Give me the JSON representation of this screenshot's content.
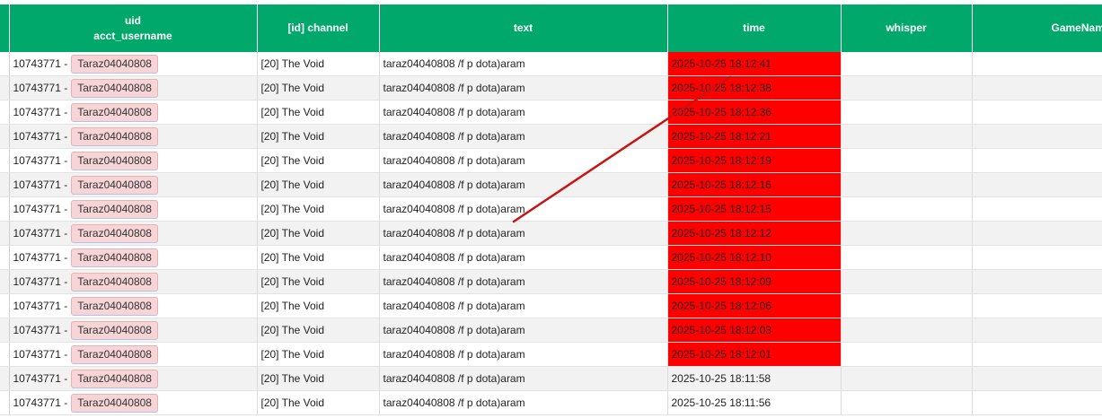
{
  "table": {
    "headers": {
      "uid_top": "uid",
      "uid_bottom": "acct_username",
      "channel": "[id] channel",
      "text": "text",
      "time": "time",
      "whisper": "whisper",
      "gamename": "GameNam"
    },
    "rows": [
      {
        "uid": "10743771 -",
        "username": "Taraz04040808",
        "channel": "[20] The Void",
        "text": "taraz04040808 /f p dota)aram",
        "time": "2025-10-25 18:12:41",
        "highlight": true
      },
      {
        "uid": "10743771 -",
        "username": "Taraz04040808",
        "channel": "[20] The Void",
        "text": "taraz04040808 /f p dota)aram",
        "time": "2025-10-25 18:12:38",
        "highlight": true
      },
      {
        "uid": "10743771 -",
        "username": "Taraz04040808",
        "channel": "[20] The Void",
        "text": "taraz04040808 /f p dota)aram",
        "time": "2025-10-25 18:12:36",
        "highlight": true
      },
      {
        "uid": "10743771 -",
        "username": "Taraz04040808",
        "channel": "[20] The Void",
        "text": "taraz04040808 /f p dota)aram",
        "time": "2025-10-25 18:12:21",
        "highlight": true
      },
      {
        "uid": "10743771 -",
        "username": "Taraz04040808",
        "channel": "[20] The Void",
        "text": "taraz04040808 /f p dota)aram",
        "time": "2025-10-25 18:12:19",
        "highlight": true
      },
      {
        "uid": "10743771 -",
        "username": "Taraz04040808",
        "channel": "[20] The Void",
        "text": "taraz04040808 /f p dota)aram",
        "time": "2025-10-25 18:12:16",
        "highlight": true
      },
      {
        "uid": "10743771 -",
        "username": "Taraz04040808",
        "channel": "[20] The Void",
        "text": "taraz04040808 /f p dota)aram",
        "time": "2025-10-25 18:12:15",
        "highlight": true
      },
      {
        "uid": "10743771 -",
        "username": "Taraz04040808",
        "channel": "[20] The Void",
        "text": "taraz04040808 /f p dota)aram",
        "time": "2025-10-25 18:12:12",
        "highlight": true
      },
      {
        "uid": "10743771 -",
        "username": "Taraz04040808",
        "channel": "[20] The Void",
        "text": "taraz04040808 /f p dota)aram",
        "time": "2025-10-25 18:12:10",
        "highlight": true
      },
      {
        "uid": "10743771 -",
        "username": "Taraz04040808",
        "channel": "[20] The Void",
        "text": "taraz04040808 /f p dota)aram",
        "time": "2025-10-25 18:12:09",
        "highlight": true
      },
      {
        "uid": "10743771 -",
        "username": "Taraz04040808",
        "channel": "[20] The Void",
        "text": "taraz04040808 /f p dota)aram",
        "time": "2025-10-25 18:12:06",
        "highlight": true
      },
      {
        "uid": "10743771 -",
        "username": "Taraz04040808",
        "channel": "[20] The Void",
        "text": "taraz04040808 /f p dota)aram",
        "time": "2025-10-25 18:12:03",
        "highlight": true
      },
      {
        "uid": "10743771 -",
        "username": "Taraz04040808",
        "channel": "[20] The Void",
        "text": "taraz04040808 /f p dota)aram",
        "time": "2025-10-25 18:12:01",
        "highlight": true
      },
      {
        "uid": "10743771 -",
        "username": "Taraz04040808",
        "channel": "[20] The Void",
        "text": "taraz04040808 /f p dota)aram",
        "time": "2025-10-25 18:11:58",
        "highlight": false
      },
      {
        "uid": "10743771 -",
        "username": "Taraz04040808",
        "channel": "[20] The Void",
        "text": "taraz04040808 /f p dota)aram",
        "time": "2025-10-25 18:11:56",
        "highlight": false
      }
    ]
  },
  "colors": {
    "header_green": "#00a96b",
    "highlight_red": "#ff0000",
    "annotation_line": "#cc1111",
    "username_chip": "#f7d5d7"
  },
  "annotation": {
    "type": "red-arrow-line",
    "description_icon": "annotation-line"
  }
}
